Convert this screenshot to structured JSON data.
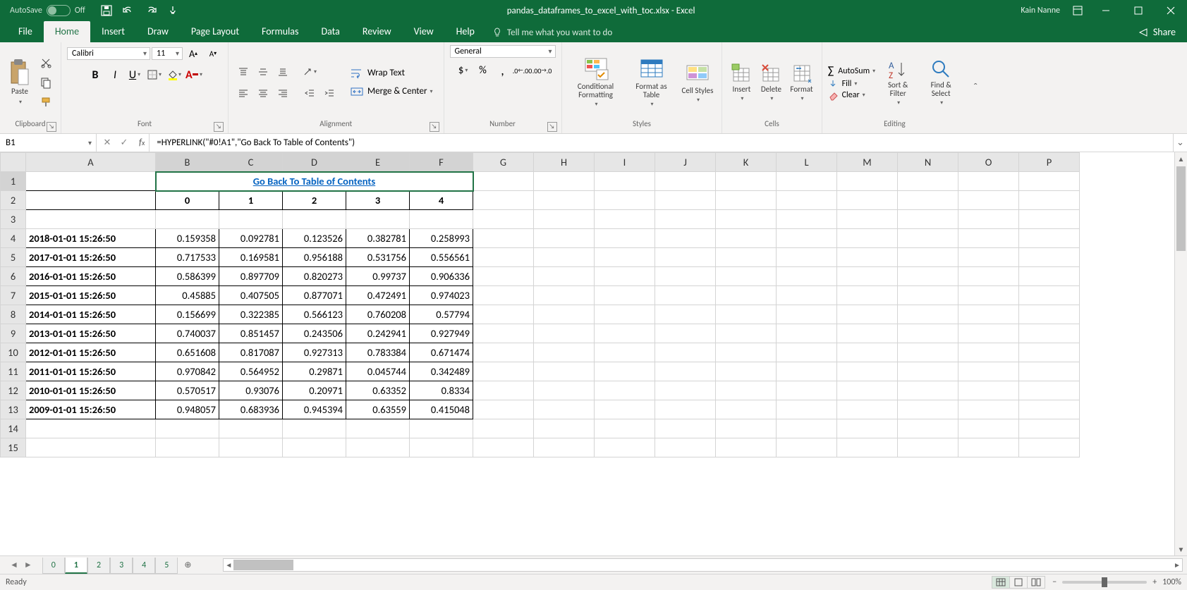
{
  "titlebar": {
    "autosave_label": "AutoSave",
    "autosave_state": "Off",
    "title": "pandas_dataframes_to_excel_with_toc.xlsx - Excel",
    "user": "Kain Nanne"
  },
  "tabs": [
    "File",
    "Home",
    "Insert",
    "Draw",
    "Page Layout",
    "Formulas",
    "Data",
    "Review",
    "View",
    "Help"
  ],
  "active_tab_index": 1,
  "tellme": "Tell me what you want to do",
  "share": "Share",
  "ribbon": {
    "clipboard": {
      "paste": "Paste",
      "label": "Clipboard"
    },
    "font": {
      "family": "Calibri",
      "size": "11",
      "label": "Font"
    },
    "alignment": {
      "wrap": "Wrap Text",
      "merge": "Merge & Center",
      "label": "Alignment"
    },
    "number": {
      "format": "General",
      "label": "Number"
    },
    "styles": {
      "cond": "Conditional Formatting",
      "fmtTable": "Format as Table",
      "cell": "Cell Styles",
      "label": "Styles"
    },
    "cells": {
      "insert": "Insert",
      "delete": "Delete",
      "format": "Format",
      "label": "Cells"
    },
    "editing": {
      "sum": "AutoSum",
      "fill": "Fill",
      "clear": "Clear",
      "sort": "Sort & Filter",
      "find": "Find & Select",
      "label": "Editing"
    }
  },
  "formula_bar": {
    "cell_ref": "B1",
    "formula": "=HYPERLINK(\"#0!A1\",\"Go Back To Table of Contents\")"
  },
  "columns": [
    "A",
    "B",
    "C",
    "D",
    "E",
    "F",
    "G",
    "H",
    "I",
    "J",
    "K",
    "L",
    "M",
    "N",
    "O",
    "P"
  ],
  "row_numbers": [
    1,
    2,
    3,
    4,
    5,
    6,
    7,
    8,
    9,
    10,
    11,
    12,
    13,
    14,
    15
  ],
  "sheet": {
    "link_text": "Go Back To Table of Contents",
    "headers": [
      "0",
      "1",
      "2",
      "3",
      "4"
    ],
    "rows": [
      {
        "ts": "2018-01-01 15:26:50",
        "v": [
          "0.159358",
          "0.092781",
          "0.123526",
          "0.382781",
          "0.258993"
        ]
      },
      {
        "ts": "2017-01-01 15:26:50",
        "v": [
          "0.717533",
          "0.169581",
          "0.956188",
          "0.531756",
          "0.556561"
        ]
      },
      {
        "ts": "2016-01-01 15:26:50",
        "v": [
          "0.586399",
          "0.897709",
          "0.820273",
          "0.99737",
          "0.906336"
        ]
      },
      {
        "ts": "2015-01-01 15:26:50",
        "v": [
          "0.45885",
          "0.407505",
          "0.877071",
          "0.472491",
          "0.974023"
        ]
      },
      {
        "ts": "2014-01-01 15:26:50",
        "v": [
          "0.156699",
          "0.322385",
          "0.566123",
          "0.760208",
          "0.57794"
        ]
      },
      {
        "ts": "2013-01-01 15:26:50",
        "v": [
          "0.740037",
          "0.851457",
          "0.243506",
          "0.242941",
          "0.927949"
        ]
      },
      {
        "ts": "2012-01-01 15:26:50",
        "v": [
          "0.651608",
          "0.817087",
          "0.927313",
          "0.783384",
          "0.671474"
        ]
      },
      {
        "ts": "2011-01-01 15:26:50",
        "v": [
          "0.970842",
          "0.564952",
          "0.29871",
          "0.045744",
          "0.342489"
        ]
      },
      {
        "ts": "2010-01-01 15:26:50",
        "v": [
          "0.570517",
          "0.93076",
          "0.20971",
          "0.63352",
          "0.8334"
        ]
      },
      {
        "ts": "2009-01-01 15:26:50",
        "v": [
          "0.948057",
          "0.683936",
          "0.945394",
          "0.63559",
          "0.415048"
        ]
      }
    ]
  },
  "sheet_tabs": [
    "0",
    "1",
    "2",
    "3",
    "4",
    "5"
  ],
  "active_sheet_index": 1,
  "status": {
    "ready": "Ready",
    "zoom": "100%"
  }
}
